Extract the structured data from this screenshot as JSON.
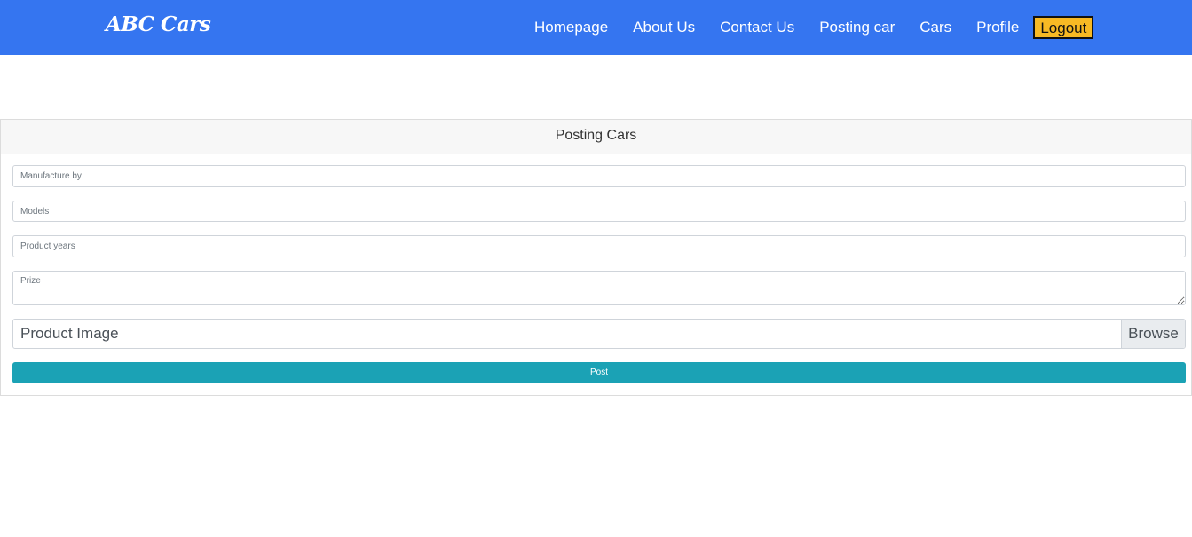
{
  "navbar": {
    "brand": "ABC Cars",
    "links": [
      {
        "label": "Homepage"
      },
      {
        "label": "About Us"
      },
      {
        "label": "Contact Us"
      },
      {
        "label": "Posting car"
      },
      {
        "label": "Cars"
      },
      {
        "label": "Profile"
      }
    ],
    "logout_label": "Logout"
  },
  "form": {
    "title": "Posting Cars",
    "manufacture_placeholder": "Manufacture by",
    "models_placeholder": "Models",
    "years_placeholder": "Product years",
    "prize_placeholder": "Prize",
    "image_label": "Product Image",
    "browse_label": "Browse",
    "post_label": "Post"
  },
  "colors": {
    "navbar_bg": "#3575f0",
    "logout_bg": "#f7b924",
    "post_bg": "#1ba2b5"
  }
}
